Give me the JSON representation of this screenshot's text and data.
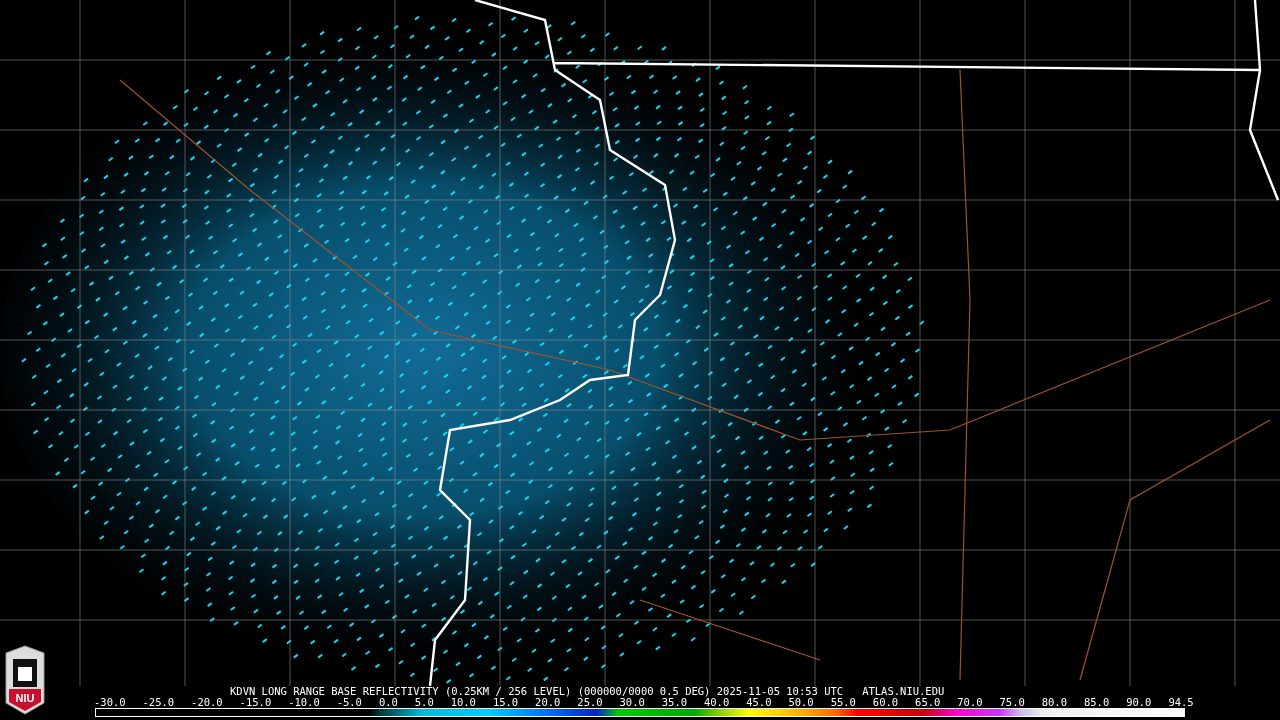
{
  "logo": {
    "text": "NIU"
  },
  "title": "KDVN LONG RANGE BASE REFLECTIVITY (0.25KM / 256 LEVEL) (000000/0000 0.5 DEG) 2025-11-05 10:53 UTC   ATLAS.NIU.EDU",
  "scale_labels": [
    "-30.0",
    "-25.0",
    "-20.0",
    "-15.0",
    "-10.0",
    "-5.0",
    "0.0",
    "5.0",
    "10.0",
    "15.0",
    "20.0",
    "25.0",
    "30.0",
    "35.0",
    "40.0",
    "45.0",
    "50.0",
    "55.0",
    "60.0",
    "65.0",
    "70.0",
    "75.0",
    "80.0",
    "85.0",
    "90.0",
    "94.5"
  ]
}
